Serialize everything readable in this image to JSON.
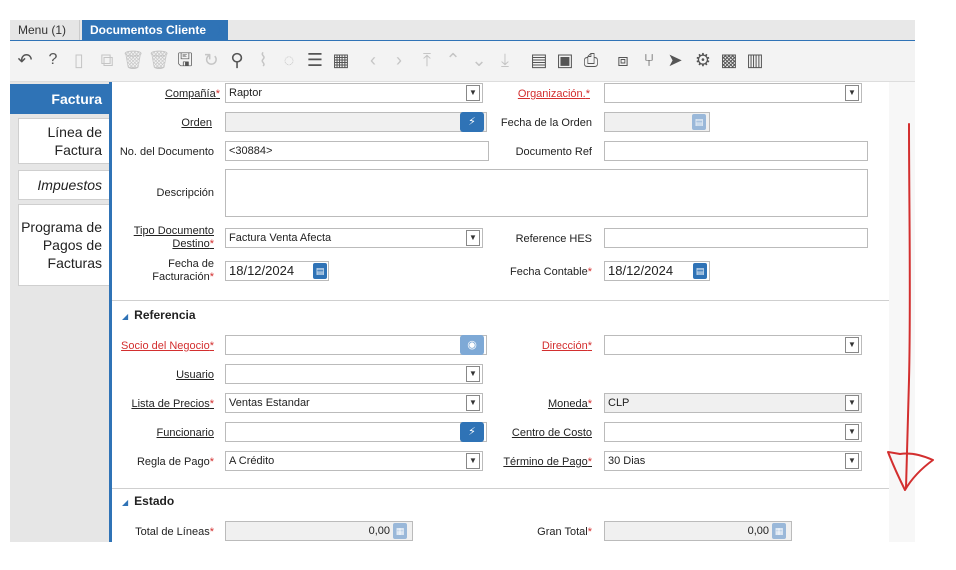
{
  "window_tabs": {
    "menu": "Menu (1)",
    "active": "Documentos Cliente",
    "close": "╳"
  },
  "side_tabs": [
    {
      "label": "Factura"
    },
    {
      "label": "Línea de Factura"
    },
    {
      "label": "Impuestos"
    },
    {
      "label": "Programa de Pagos de Facturas"
    }
  ],
  "fields": {
    "compania": {
      "label": "Compañía",
      "value": "Raptor"
    },
    "organizacion": {
      "label": "Organización.",
      "value": ""
    },
    "orden": {
      "label": "Orden",
      "value": ""
    },
    "fecha_orden": {
      "label": "Fecha de la Orden",
      "value": ""
    },
    "no_documento": {
      "label": "No. del Documento",
      "value": "<30884>"
    },
    "documento_ref": {
      "label": "Documento Ref",
      "value": ""
    },
    "descripcion": {
      "label": "Descripción",
      "value": ""
    },
    "tipo_documento": {
      "label": "Tipo Documento Destino",
      "value": "Factura Venta Afecta"
    },
    "reference_hes": {
      "label": "Reference HES",
      "value": ""
    },
    "fecha_facturacion": {
      "label": "Fecha de Facturación",
      "value": "18/12/2024"
    },
    "fecha_contable": {
      "label": "Fecha Contable",
      "value": "18/12/2024"
    }
  },
  "sections": {
    "referencia": "Referencia",
    "estado": "Estado"
  },
  "ref_fields": {
    "socio": {
      "label": "Socio del Negocio",
      "value": ""
    },
    "direccion": {
      "label": "Dirección",
      "value": ""
    },
    "usuario": {
      "label": "Usuario",
      "value": ""
    },
    "lista_precios": {
      "label": "Lista de Precios",
      "value": "Ventas Estandar"
    },
    "moneda": {
      "label": "Moneda",
      "value": "CLP"
    },
    "funcionario": {
      "label": "Funcionario",
      "value": ""
    },
    "centro_costo": {
      "label": "Centro de Costo",
      "value": ""
    },
    "regla_pago": {
      "label": "Regla de Pago",
      "value": "A Crédito"
    },
    "termino_pago": {
      "label": "Término de Pago",
      "value": "30 Dias"
    }
  },
  "estado_fields": {
    "total_lineas": {
      "label": "Total de Líneas",
      "value": "0,00"
    },
    "gran_total": {
      "label": "Gran Total",
      "value": "0,00"
    }
  },
  "colors": {
    "accent": "#2f73b6",
    "required": "#d32f2f",
    "annotation": "#d32f2f"
  }
}
